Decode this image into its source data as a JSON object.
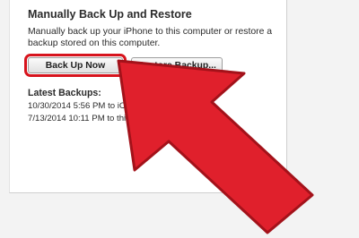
{
  "backup_section": {
    "title": "Manually Back Up and Restore",
    "description": "Manually back up your iPhone to this computer or restore a backup stored on this computer.",
    "back_up_now_label": "Back Up Now",
    "restore_backup_label": "Restore Backup..."
  },
  "latest_backups": {
    "title": "Latest Backups:",
    "entries": [
      "10/30/2014 5:56 PM to iCloud",
      "7/13/2014 10:11 PM to this computer"
    ]
  },
  "annotation": {
    "highlight_color": "#d7141d",
    "arrow_color": "#e0202c"
  }
}
